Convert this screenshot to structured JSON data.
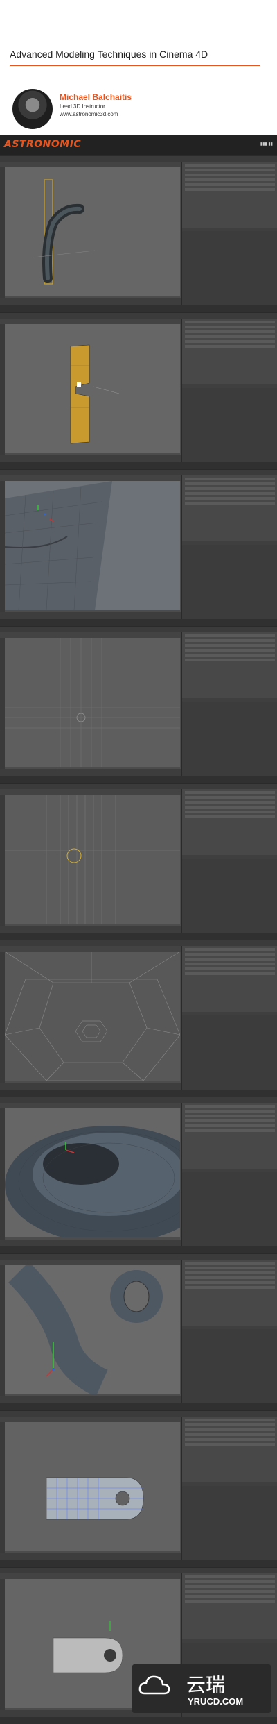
{
  "header": {
    "title": "Advanced Modeling Techniques in Cinema 4D",
    "presenter_name": "Michael Balchaitis",
    "presenter_role": "Lead 3D Instructor",
    "presenter_site": "www.astronomic3d.com"
  },
  "brand": {
    "logo": "ASTRONOMIC",
    "accent": "#e8541e"
  },
  "frames": [
    {
      "scene": "bent-tube-with-bounding-box"
    },
    {
      "scene": "flat-plate-with-notch"
    },
    {
      "scene": "curved-surface-closeup"
    },
    {
      "scene": "cylinder-top-view"
    },
    {
      "scene": "cylinder-front-wireframe"
    },
    {
      "scene": "radial-mesh-wireframe"
    },
    {
      "scene": "torus-shaded"
    },
    {
      "scene": "hook-shaded"
    },
    {
      "scene": "tab-with-hole-polygon-selection"
    },
    {
      "scene": "tab-with-hole-flat"
    }
  ],
  "watermark": {
    "chinese": "云瑞",
    "domain": "YRUCD.COM"
  }
}
